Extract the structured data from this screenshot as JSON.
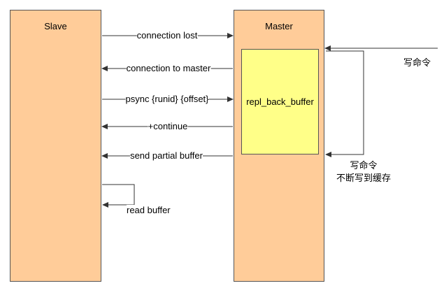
{
  "diagram": {
    "slave_label": "Slave",
    "master_label": "Master",
    "buffer_label": "repl_back_buffer",
    "messages": {
      "connection_lost": "connection lost",
      "connection_to_master": "connection to master",
      "psync": "psync {runid} {offset}",
      "continue": "+continue",
      "send_partial_buffer": "send partial buffer",
      "read_buffer": "read buffer"
    },
    "write_command": "写命令",
    "write_loop_line1": "写命令",
    "write_loop_line2": "不断写到缓存"
  }
}
